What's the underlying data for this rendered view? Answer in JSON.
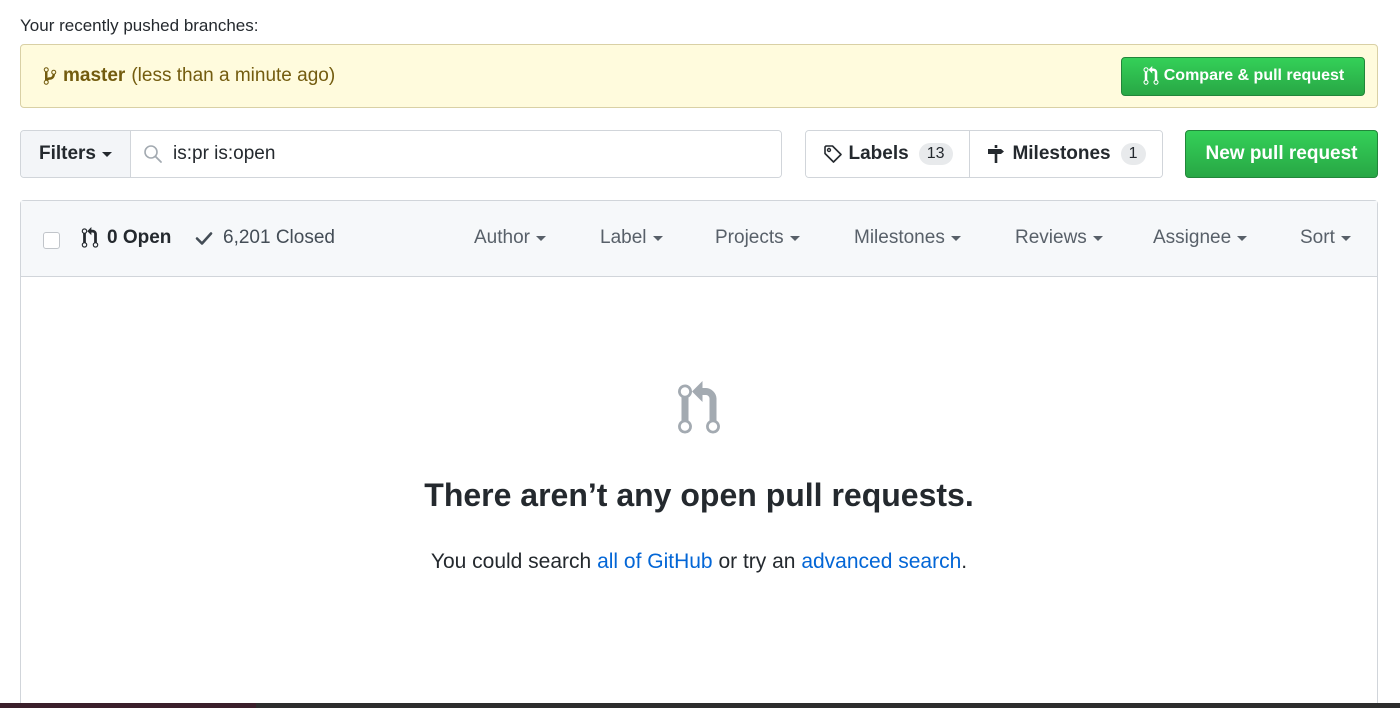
{
  "recent": {
    "label": "Your recently pushed branches:"
  },
  "banner": {
    "branch": "master",
    "time": "(less than a minute ago)",
    "compare_label": "Compare & pull request"
  },
  "toolbar": {
    "filters_label": "Filters",
    "search_value": "is:pr is:open",
    "labels_label": "Labels",
    "labels_count": "13",
    "milestones_label": "Milestones",
    "milestones_count": "1",
    "new_pr_label": "New pull request"
  },
  "list_header": {
    "open": "0 Open",
    "closed": "6,201 Closed",
    "menus": [
      "Author",
      "Label",
      "Projects",
      "Milestones",
      "Reviews",
      "Assignee",
      "Sort"
    ]
  },
  "blankslate": {
    "title": "There aren’t any open pull requests.",
    "text_prefix": "You could search ",
    "link1": "all of GitHub",
    "text_mid": " or try an ",
    "link2": "advanced search",
    "text_suffix": "."
  },
  "colors": {
    "banner_bg": "#fffbdd",
    "banner_text": "#735c0f",
    "primary_green": "#28a745",
    "link_blue": "#0366d6",
    "header_bg": "#f6f8fa"
  },
  "icons": [
    "git-branch-icon",
    "git-pull-request-icon",
    "search-icon",
    "tag-icon",
    "milestone-icon",
    "check-icon"
  ]
}
